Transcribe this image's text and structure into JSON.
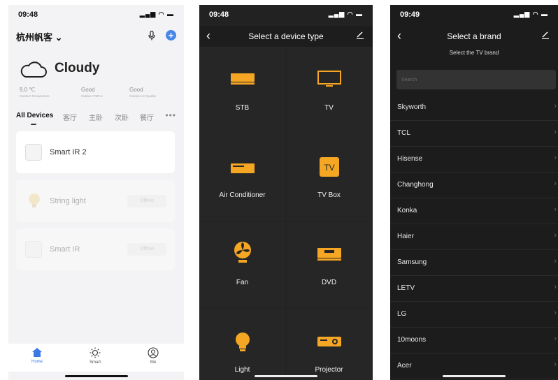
{
  "screen1": {
    "time": "09:48",
    "signal": "▂▄▆ ◠ ▬",
    "home_name": "杭州帆客 ⌄",
    "weather": "Cloudy",
    "metrics": [
      {
        "value": "9.0 ℃",
        "label": "Outdoor Temperature"
      },
      {
        "value": "Good",
        "label": "Outdoor PM2.5"
      },
      {
        "value": "Good",
        "label": "Outdoor Air Quality"
      }
    ],
    "rooms": [
      "All Devices",
      "客厅",
      "主卧",
      "次卧",
      "餐厅"
    ],
    "more": "•••",
    "devices": [
      {
        "name": "Smart IR 2",
        "status": ""
      },
      {
        "name": "String light",
        "status": "Offline"
      },
      {
        "name": "Smart IR",
        "status": "Offline"
      }
    ],
    "tabs": [
      {
        "label": "Home"
      },
      {
        "label": "Smart"
      },
      {
        "label": "Me"
      }
    ],
    "accent": "#3b78e7"
  },
  "screen2": {
    "time": "09:48",
    "signal": "▂▄▆ ◠ ▬",
    "title": "Select a device type",
    "devices": [
      {
        "label": "STB",
        "icon": "stb-icon"
      },
      {
        "label": "TV",
        "icon": "tv-icon"
      },
      {
        "label": "Air Conditioner",
        "icon": "air-conditioner-icon"
      },
      {
        "label": "TV Box",
        "icon": "tv-box-icon",
        "icon_text": "TV"
      },
      {
        "label": "Fan",
        "icon": "fan-icon"
      },
      {
        "label": "DVD",
        "icon": "dvd-icon"
      },
      {
        "label": "Light",
        "icon": "light-bulb-icon"
      },
      {
        "label": "Projector",
        "icon": "projector-icon"
      }
    ],
    "accent": "#f5a623"
  },
  "screen3": {
    "time": "09:49",
    "signal": "▂▄▆ ◠ ▬",
    "title": "Select a brand",
    "subtitle": "Select the TV brand",
    "search_placeholder": "Search",
    "brands": [
      "Skyworth",
      "TCL",
      "Hisense",
      "Changhong",
      "Konka",
      "Haier",
      "Samsung",
      "LETV",
      "LG",
      "10moons",
      "Acer"
    ]
  }
}
